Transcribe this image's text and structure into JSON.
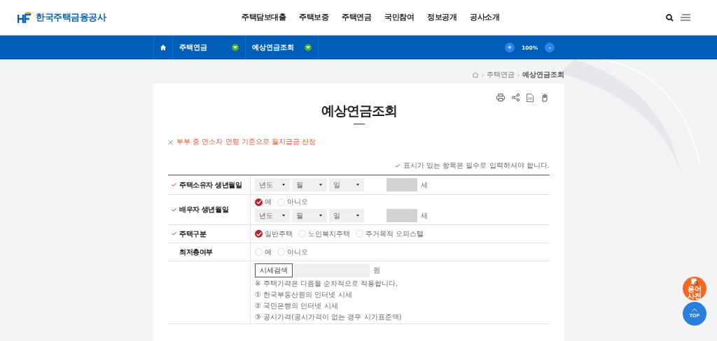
{
  "header": {
    "logo_text": "한국주택금융공사",
    "nav": [
      {
        "label": "주택담보대출"
      },
      {
        "label": "주택보증"
      },
      {
        "label": "주택연금"
      },
      {
        "label": "국민참여"
      },
      {
        "label": "정보공개"
      },
      {
        "label": "공사소개"
      }
    ]
  },
  "subnav": {
    "menus": [
      {
        "label": "주택연금"
      },
      {
        "label": "예상연금조회"
      }
    ],
    "zoom": {
      "plus": "+",
      "level": "100%",
      "minus": "-"
    }
  },
  "breadcrumb": [
    "주택연금",
    "예상연금조회"
  ],
  "title": "예상연금조회",
  "notice": "부부 중 연소자 연령 기준으로 월지급금 산정",
  "required_note": "표시가 있는 항목은 필수로 입력하셔야 합니다.",
  "form": [
    {
      "kind": "date",
      "label": "주택소유자 생년월일",
      "required": true,
      "selects": [
        "년도",
        "월",
        "일"
      ],
      "unit": "세"
    },
    {
      "kind": "radio_date",
      "label": "배우자 생년월일",
      "required": true,
      "options": [
        {
          "label": "예",
          "selected": true
        },
        {
          "label": "아니오",
          "selected": false
        }
      ],
      "selects": [
        "년도",
        "월",
        "일"
      ],
      "unit": "세"
    },
    {
      "kind": "radio",
      "label": "주택구분",
      "required": true,
      "options": [
        {
          "label": "일반주택",
          "selected": true
        },
        {
          "label": "노인복지주택",
          "selected": false
        },
        {
          "label": "주거목적 오피스텔",
          "selected": false
        }
      ]
    },
    {
      "kind": "radio",
      "label": "최저층여부",
      "required": false,
      "options": [
        {
          "label": "예",
          "selected": false
        },
        {
          "label": "아니오",
          "selected": false
        }
      ]
    },
    {
      "kind": "price",
      "button": "시세검색",
      "unit": "원",
      "note": "※ 주택가격은 다음을 순차적으로 적용합니다.",
      "items": [
        "① 한국부동산원의 인터넷 시세",
        "② 국민은행의 인터넷 시세",
        "③ 공시가격(공시가격이 없는 경우 시가표준액)"
      ]
    }
  ],
  "float_buttons": {
    "dictionary": "용어사전",
    "top": "TOP"
  }
}
